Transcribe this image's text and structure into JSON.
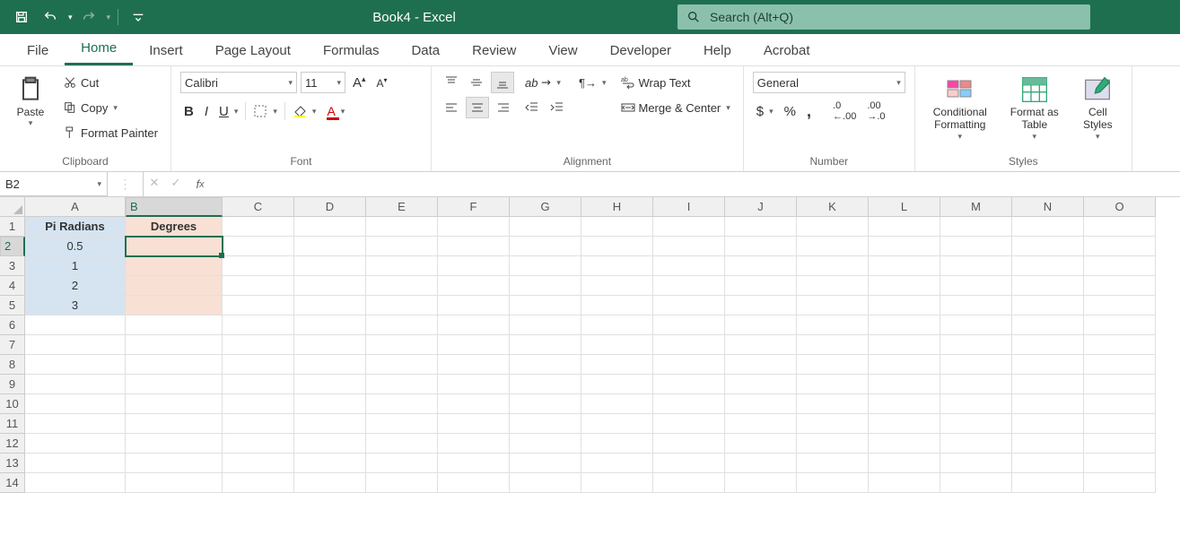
{
  "title": "Book4  -  Excel",
  "search_placeholder": "Search (Alt+Q)",
  "tabs": [
    "File",
    "Home",
    "Insert",
    "Page Layout",
    "Formulas",
    "Data",
    "Review",
    "View",
    "Developer",
    "Help",
    "Acrobat"
  ],
  "active_tab": "Home",
  "clipboard": {
    "paste": "Paste",
    "cut": "Cut",
    "copy": "Copy",
    "format_painter": "Format Painter",
    "label": "Clipboard"
  },
  "font": {
    "name": "Calibri",
    "size": "11",
    "label": "Font"
  },
  "alignment": {
    "wrap": "Wrap Text",
    "merge": "Merge & Center",
    "label": "Alignment"
  },
  "number": {
    "format": "General",
    "label": "Number"
  },
  "styles": {
    "cond": "Conditional Formatting",
    "table": "Format as Table",
    "cell": "Cell Styles",
    "label": "Styles"
  },
  "name_box": "B2",
  "formula": "",
  "columns": [
    "A",
    "B",
    "C",
    "D",
    "E",
    "F",
    "G",
    "H",
    "I",
    "J",
    "K",
    "L",
    "M",
    "N",
    "O"
  ],
  "rows": 14,
  "selected_col": "B",
  "selected_row": 2,
  "sheet": {
    "A1": "Pi Radians",
    "B1": "Degrees",
    "A2": "0.5",
    "A3": "1",
    "A4": "2",
    "A5": "3"
  }
}
